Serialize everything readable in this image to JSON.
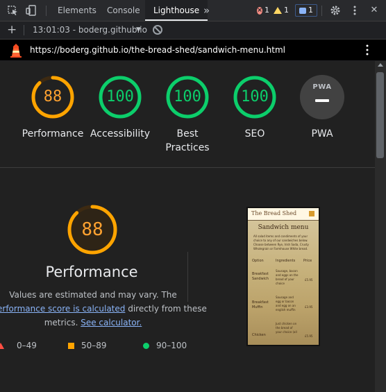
{
  "devtools": {
    "tabs": [
      "Elements",
      "Console",
      "Lighthouse"
    ],
    "active_tab": "Lighthouse",
    "overflow_label": "»",
    "errors_count": "1",
    "warnings_count": "1",
    "messages_count": "1",
    "icons": [
      "inspect-element-icon",
      "device-toolbar-icon",
      "more-tabs-icon",
      "settings-gear-icon",
      "kebab-menu-icon"
    ]
  },
  "report_bar": {
    "add_label": "+",
    "selected_report": "13:01:03 - boderg.github.io",
    "caret": "▼"
  },
  "url_bar": {
    "url": "https://boderg.github.io/the-bread-shed/sandwich-menu.html"
  },
  "scores": [
    {
      "label": "Performance",
      "value": "88",
      "fraction": 0.88,
      "color": "#ffa400",
      "text_color": "#ffa230"
    },
    {
      "label": "Accessibility",
      "value": "100",
      "fraction": 1.0,
      "color": "#0cce6b",
      "text_color": "#0cce6b"
    },
    {
      "label": "Best Practices",
      "value": "100",
      "fraction": 1.0,
      "color": "#0cce6b",
      "text_color": "#0cce6b"
    },
    {
      "label": "SEO",
      "value": "100",
      "fraction": 1.0,
      "color": "#0cce6b",
      "text_color": "#0cce6b"
    },
    {
      "label": "PWA",
      "badge": "PWA"
    }
  ],
  "performance": {
    "score": "88",
    "fraction": 0.88,
    "title": "Performance",
    "desc_part1": "Values are estimated and may vary. The",
    "link_score": "erformance score is calculated",
    "desc_part2": " directly from these",
    "desc_part3": "metrics. ",
    "link_calculator": "See calculator."
  },
  "legend": [
    {
      "range": "0–49",
      "color": "#ff4e42"
    },
    {
      "range": "50–89",
      "color": "#ffa400"
    },
    {
      "range": "90–100",
      "color": "#0cce6b"
    }
  ],
  "thumbnail": {
    "brand": "The Bread Shed",
    "title": "Sandwich menu",
    "intro": "All salad items and condiments of your choice to any of our sandwiches below. Choose between Rye, Irish Soda, Crusty Wholegrain or Farmhouse White bread.",
    "columns": [
      "Option",
      "Ingredients",
      "Price"
    ],
    "rows": [
      {
        "option": "Breakfast Sandwich",
        "ingredients": "Sausage, bacon and eggs on the bread of your choice",
        "price": "£5.95"
      },
      {
        "option": "Breakfast Muffin",
        "ingredients": "Sausage and egg or bacon and egg on an english muffin",
        "price": "£3.95"
      },
      {
        "option": "Chicken",
        "ingredients": "Just chicken on the bread of your choice (all",
        "price": "£5.95"
      }
    ]
  }
}
